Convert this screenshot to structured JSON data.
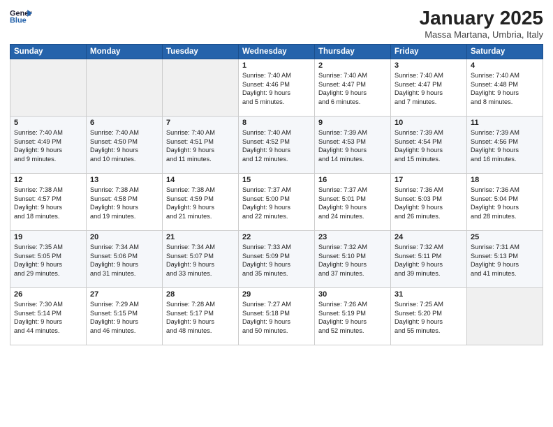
{
  "header": {
    "logo_line1": "General",
    "logo_line2": "Blue",
    "month_title": "January 2025",
    "location": "Massa Martana, Umbria, Italy"
  },
  "weekdays": [
    "Sunday",
    "Monday",
    "Tuesday",
    "Wednesday",
    "Thursday",
    "Friday",
    "Saturday"
  ],
  "weeks": [
    [
      {
        "day": "",
        "content": ""
      },
      {
        "day": "",
        "content": ""
      },
      {
        "day": "",
        "content": ""
      },
      {
        "day": "1",
        "content": "Sunrise: 7:40 AM\nSunset: 4:46 PM\nDaylight: 9 hours\nand 5 minutes."
      },
      {
        "day": "2",
        "content": "Sunrise: 7:40 AM\nSunset: 4:47 PM\nDaylight: 9 hours\nand 6 minutes."
      },
      {
        "day": "3",
        "content": "Sunrise: 7:40 AM\nSunset: 4:47 PM\nDaylight: 9 hours\nand 7 minutes."
      },
      {
        "day": "4",
        "content": "Sunrise: 7:40 AM\nSunset: 4:48 PM\nDaylight: 9 hours\nand 8 minutes."
      }
    ],
    [
      {
        "day": "5",
        "content": "Sunrise: 7:40 AM\nSunset: 4:49 PM\nDaylight: 9 hours\nand 9 minutes."
      },
      {
        "day": "6",
        "content": "Sunrise: 7:40 AM\nSunset: 4:50 PM\nDaylight: 9 hours\nand 10 minutes."
      },
      {
        "day": "7",
        "content": "Sunrise: 7:40 AM\nSunset: 4:51 PM\nDaylight: 9 hours\nand 11 minutes."
      },
      {
        "day": "8",
        "content": "Sunrise: 7:40 AM\nSunset: 4:52 PM\nDaylight: 9 hours\nand 12 minutes."
      },
      {
        "day": "9",
        "content": "Sunrise: 7:39 AM\nSunset: 4:53 PM\nDaylight: 9 hours\nand 14 minutes."
      },
      {
        "day": "10",
        "content": "Sunrise: 7:39 AM\nSunset: 4:54 PM\nDaylight: 9 hours\nand 15 minutes."
      },
      {
        "day": "11",
        "content": "Sunrise: 7:39 AM\nSunset: 4:56 PM\nDaylight: 9 hours\nand 16 minutes."
      }
    ],
    [
      {
        "day": "12",
        "content": "Sunrise: 7:38 AM\nSunset: 4:57 PM\nDaylight: 9 hours\nand 18 minutes."
      },
      {
        "day": "13",
        "content": "Sunrise: 7:38 AM\nSunset: 4:58 PM\nDaylight: 9 hours\nand 19 minutes."
      },
      {
        "day": "14",
        "content": "Sunrise: 7:38 AM\nSunset: 4:59 PM\nDaylight: 9 hours\nand 21 minutes."
      },
      {
        "day": "15",
        "content": "Sunrise: 7:37 AM\nSunset: 5:00 PM\nDaylight: 9 hours\nand 22 minutes."
      },
      {
        "day": "16",
        "content": "Sunrise: 7:37 AM\nSunset: 5:01 PM\nDaylight: 9 hours\nand 24 minutes."
      },
      {
        "day": "17",
        "content": "Sunrise: 7:36 AM\nSunset: 5:03 PM\nDaylight: 9 hours\nand 26 minutes."
      },
      {
        "day": "18",
        "content": "Sunrise: 7:36 AM\nSunset: 5:04 PM\nDaylight: 9 hours\nand 28 minutes."
      }
    ],
    [
      {
        "day": "19",
        "content": "Sunrise: 7:35 AM\nSunset: 5:05 PM\nDaylight: 9 hours\nand 29 minutes."
      },
      {
        "day": "20",
        "content": "Sunrise: 7:34 AM\nSunset: 5:06 PM\nDaylight: 9 hours\nand 31 minutes."
      },
      {
        "day": "21",
        "content": "Sunrise: 7:34 AM\nSunset: 5:07 PM\nDaylight: 9 hours\nand 33 minutes."
      },
      {
        "day": "22",
        "content": "Sunrise: 7:33 AM\nSunset: 5:09 PM\nDaylight: 9 hours\nand 35 minutes."
      },
      {
        "day": "23",
        "content": "Sunrise: 7:32 AM\nSunset: 5:10 PM\nDaylight: 9 hours\nand 37 minutes."
      },
      {
        "day": "24",
        "content": "Sunrise: 7:32 AM\nSunset: 5:11 PM\nDaylight: 9 hours\nand 39 minutes."
      },
      {
        "day": "25",
        "content": "Sunrise: 7:31 AM\nSunset: 5:13 PM\nDaylight: 9 hours\nand 41 minutes."
      }
    ],
    [
      {
        "day": "26",
        "content": "Sunrise: 7:30 AM\nSunset: 5:14 PM\nDaylight: 9 hours\nand 44 minutes."
      },
      {
        "day": "27",
        "content": "Sunrise: 7:29 AM\nSunset: 5:15 PM\nDaylight: 9 hours\nand 46 minutes."
      },
      {
        "day": "28",
        "content": "Sunrise: 7:28 AM\nSunset: 5:17 PM\nDaylight: 9 hours\nand 48 minutes."
      },
      {
        "day": "29",
        "content": "Sunrise: 7:27 AM\nSunset: 5:18 PM\nDaylight: 9 hours\nand 50 minutes."
      },
      {
        "day": "30",
        "content": "Sunrise: 7:26 AM\nSunset: 5:19 PM\nDaylight: 9 hours\nand 52 minutes."
      },
      {
        "day": "31",
        "content": "Sunrise: 7:25 AM\nSunset: 5:20 PM\nDaylight: 9 hours\nand 55 minutes."
      },
      {
        "day": "",
        "content": ""
      }
    ]
  ]
}
